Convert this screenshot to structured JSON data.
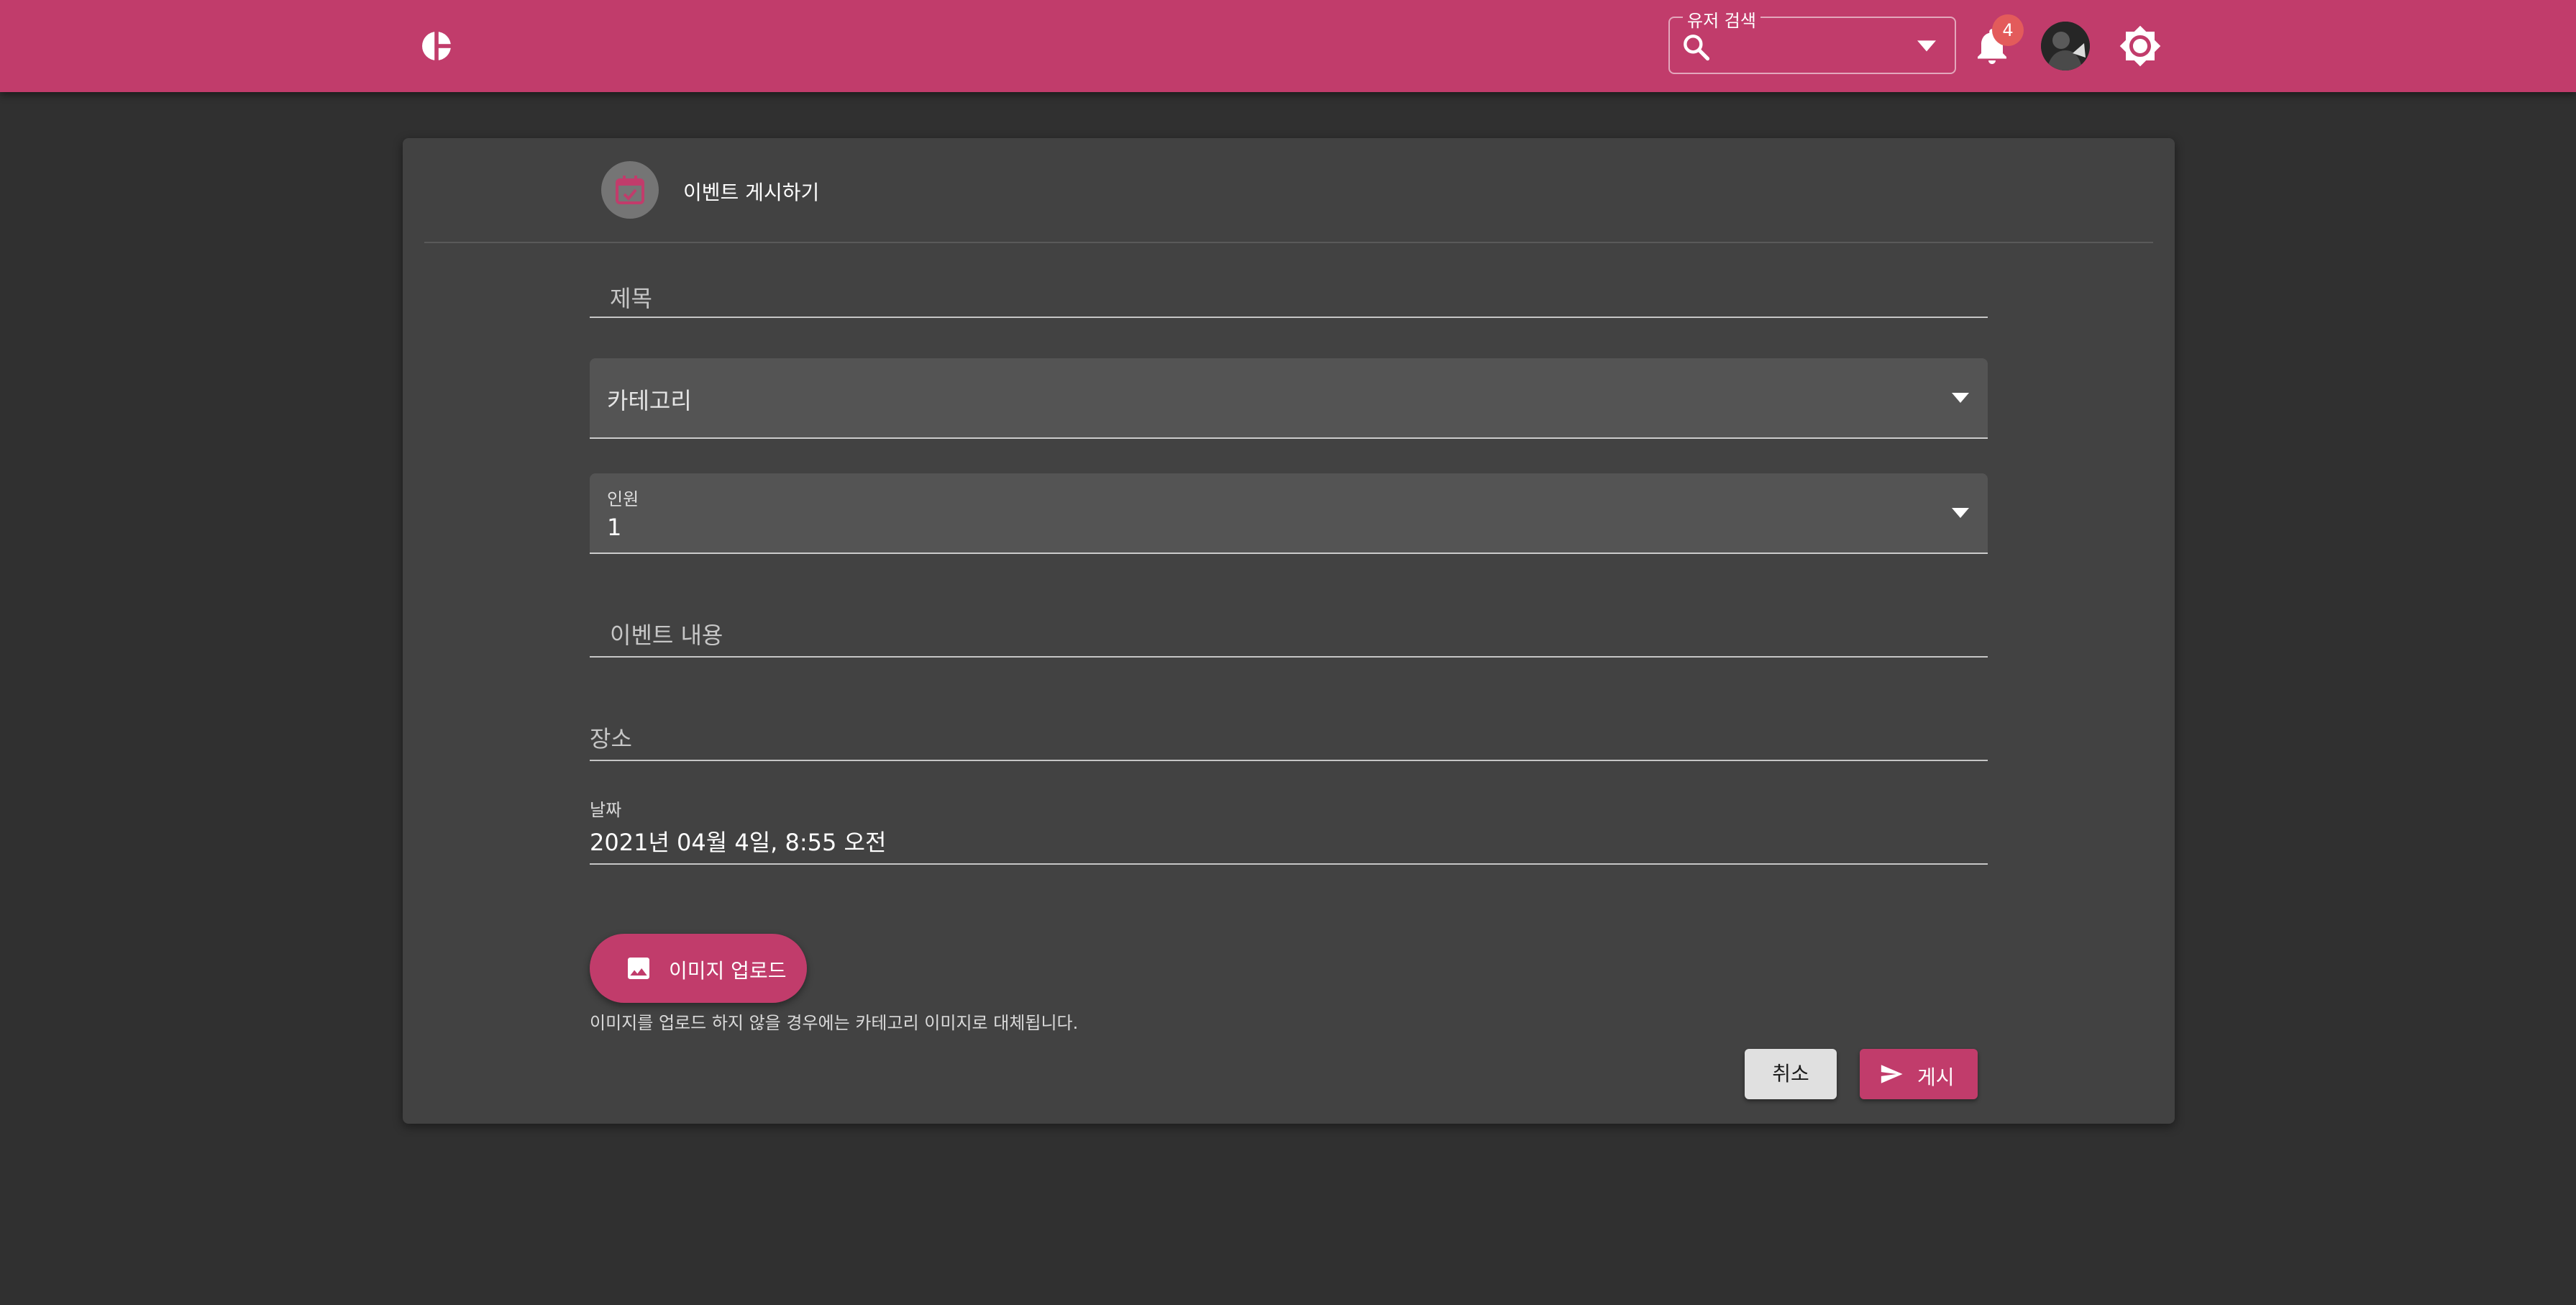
{
  "appbar": {
    "logo_icon": "logo-icon",
    "search": {
      "label": "유저 검색",
      "value": ""
    },
    "notifications": {
      "icon": "bell-icon",
      "count": "4"
    },
    "settings_icon": "gear-icon"
  },
  "form": {
    "header": {
      "icon": "calendar-check-icon",
      "title": "이벤트 게시하기"
    },
    "title_placeholder": "제목",
    "category_placeholder": "카테고리",
    "people": {
      "label": "인원",
      "value": "1"
    },
    "content_placeholder": "이벤트 내용",
    "place_placeholder": "장소",
    "date": {
      "label": "날짜",
      "value": "2021년 04월 4일, 8:55 오전"
    },
    "upload_label": "이미지 업로드",
    "upload_helper": "이미지를 업로드 하지 않을 경우에는 카테고리 이미지로 대체됩니다.",
    "cancel_label": "취소",
    "post_label": "게시"
  },
  "colors": {
    "primary": "#c13c6b",
    "background": "#303030",
    "card": "#424242",
    "badge": "#e35b5b"
  }
}
